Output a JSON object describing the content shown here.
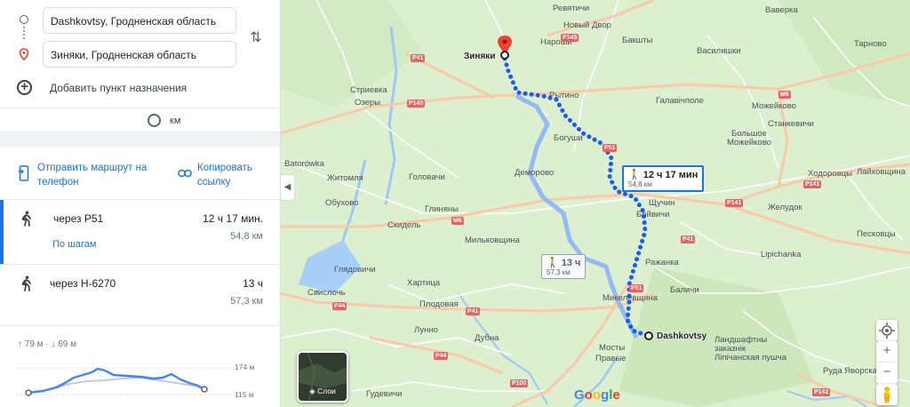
{
  "directions": {
    "origin": "Dashkovtsy, Гродненская область",
    "destination": "Зиняки, Гродненская область",
    "add_destination": "Добавить пункт назначения",
    "unit_label": "км",
    "send_to_phone": "Отправить маршрут на телефон",
    "copy_link": "Копировать ссылку",
    "routes": [
      {
        "name": "через Р51",
        "time": "12 ч 17 мин.",
        "distance": "54,8 км",
        "steps": "По шагам",
        "selected": true
      },
      {
        "name": "через Н-6270",
        "time": "13 ч",
        "distance": "57,3 км",
        "selected": false
      }
    ],
    "elevation": {
      "ascent": "↑ 79 м",
      "separator": "·",
      "descent": "↓ 69 м",
      "max": "174 м",
      "min": "115 м"
    }
  },
  "map": {
    "places": [
      "Ревятичи",
      "Новый Двор",
      "Ваверка",
      "Нароши",
      "Бакшты",
      "Тарново",
      "Василишки",
      "Зиняки",
      "Стриевка",
      "Озеры",
      "Рытино",
      "Галавічполе",
      "Можейково",
      "Станкевичи",
      "Большое Можейково",
      "Богуши",
      "Ходоровцы",
      "Лайковщина",
      "Batorówka",
      "Деморово",
      "Житомля",
      "Головачи",
      "Обухово",
      "Щучин",
      "Желудок",
      "Скидель",
      "Глиняны",
      "Бойвичи",
      "Мильковщина",
      "Песковцы",
      "Ражанка",
      "Lipichanka",
      "Глядовичи",
      "Хартица",
      "Свислочь",
      "Микелевщина",
      "Баличи",
      "Плодовая",
      "Лунно",
      "Дубна",
      "Dashkovtsy",
      "Мосты",
      "Правые",
      "Ландшафтны заказнік Ліпічанская пушча",
      "Гудевичи",
      "Руда Яворская"
    ],
    "road_badges": [
      "P145",
      "P41",
      "P145",
      "M6",
      "P51",
      "P141",
      "P41",
      "P51",
      "M6",
      "P141",
      "P44",
      "P41",
      "P44",
      "P100",
      "P142"
    ],
    "info_active": {
      "time": "12 ч 17 мин",
      "distance": "54,8 км"
    },
    "info_alt": {
      "time": "13 ч",
      "distance": "57,3 км"
    },
    "layers_label": "Слои",
    "collapse_arrow": "◀",
    "google_logo": "Google",
    "zoom_in": "+",
    "zoom_out": "−",
    "icons": [
      "my-location-icon",
      "pegman-icon",
      "walk-icon",
      "swap-icon",
      "phone-icon",
      "link-icon"
    ],
    "colors": {
      "route_active": "#1a5cf5",
      "route_alt": "#8ab4f8",
      "destination_pin": "#ea4335",
      "water": "#9fc9f5"
    }
  }
}
